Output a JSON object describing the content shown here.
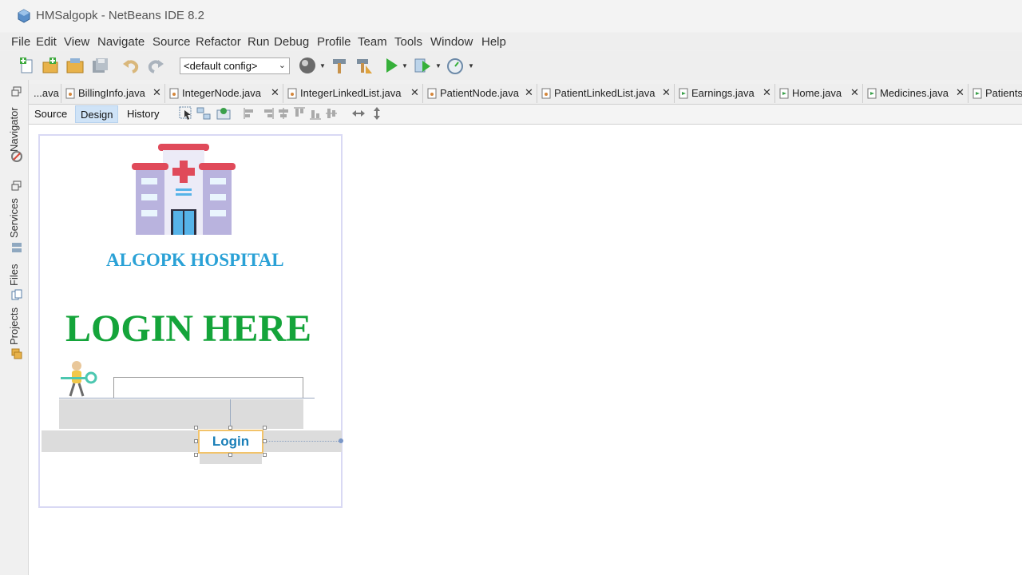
{
  "window": {
    "title": "HMSalgopk - NetBeans IDE 8.2"
  },
  "menu": [
    "File",
    "Edit",
    "View",
    "Navigate",
    "Source",
    "Refactor",
    "Run",
    "Debug",
    "Profile",
    "Team",
    "Tools",
    "Window",
    "Help"
  ],
  "toolbar": {
    "config_value": "<default config>",
    "icons": [
      "new-file-icon",
      "new-project-icon",
      "open-project-icon",
      "save-all-icon",
      "undo-icon",
      "redo-icon",
      "browser-globe-icon",
      "build-hammer-icon",
      "clean-build-icon",
      "run-icon",
      "debug-icon",
      "profile-icon"
    ]
  },
  "left_dock": {
    "tabs": [
      "Navigator",
      "Services",
      "Files",
      "Projects"
    ]
  },
  "tabs": [
    {
      "label": "...ava"
    },
    {
      "label": "BillingInfo.java"
    },
    {
      "label": "IntegerNode.java"
    },
    {
      "label": "IntegerLinkedList.java"
    },
    {
      "label": "PatientNode.java"
    },
    {
      "label": "PatientLinkedList.java"
    },
    {
      "label": "Earnings.java"
    },
    {
      "label": "Home.java"
    },
    {
      "label": "Medicines.java"
    },
    {
      "label": "Patients"
    }
  ],
  "editor_toolbar": {
    "source": "Source",
    "design": "Design",
    "history": "History",
    "active": "Design"
  },
  "form": {
    "hospital_name": "ALGOPK HOSPITAL",
    "heading": "LOGIN HERE",
    "login_button": "Login",
    "colors": {
      "hospital_name": "#2aa1d6",
      "heading": "#14a43a",
      "button_text": "#1a7fb8"
    }
  }
}
